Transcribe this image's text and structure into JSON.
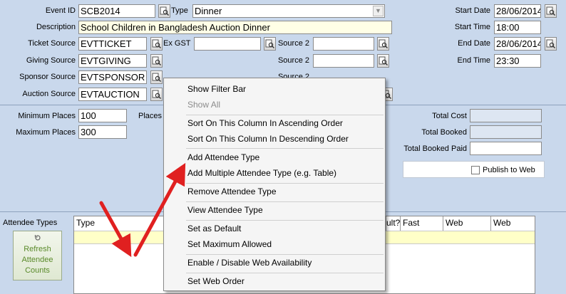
{
  "form": {
    "event_id_label": "Event ID",
    "event_id": "SCB2014",
    "type_label": "Type",
    "type_value": "Dinner",
    "description_label": "Description",
    "description": "School Children in Bangladesh Auction Dinner",
    "ticket_source_label": "Ticket Source",
    "ticket_source": "EVTTICKET",
    "ex_gst_label": "Ex GST",
    "source2_label": "Source 2",
    "giving_source_label": "Giving Source",
    "giving_source": "EVTGIVING",
    "sponsor_source_label": "Sponsor Source",
    "sponsor_source": "EVTSPONSOR",
    "auction_source_label": "Auction Source",
    "auction_source": "EVTAUCTION",
    "start_date_label": "Start Date",
    "start_date": "28/06/2014",
    "start_time_label": "Start Time",
    "start_time": "18:00",
    "end_date_label": "End Date",
    "end_date": "28/06/2014",
    "end_time_label": "End Time",
    "end_time": "23:30",
    "min_places_label": "Minimum Places",
    "min_places": "100",
    "max_places_label": "Maximum Places",
    "max_places": "300",
    "places_label": "Places",
    "total_cost_label": "Total Cost",
    "total_booked_label": "Total Booked",
    "total_booked_paid_label": "Total Booked Paid",
    "publish_label": "Publish to Web"
  },
  "attendee": {
    "label": "Attendee Types",
    "refresh_button": [
      "Refresh",
      "Attendee",
      "Counts"
    ],
    "columns": [
      "Type",
      "ult?",
      "Fast",
      "Web",
      "Web"
    ]
  },
  "context_menu": {
    "items": [
      {
        "label": "Show Filter Bar",
        "disabled": false
      },
      {
        "label": "Show All",
        "disabled": true
      },
      {
        "label": "Sort On This Column In Ascending Order",
        "disabled": false
      },
      {
        "label": "Sort On This Column In Descending Order",
        "disabled": false
      },
      {
        "label": "Add Attendee Type",
        "disabled": false
      },
      {
        "label": "Add Multiple Attendee Type (e.g. Table)",
        "disabled": false
      },
      {
        "label": "Remove Attendee Type",
        "disabled": false
      },
      {
        "label": "View Attendee Type",
        "disabled": false
      },
      {
        "label": "Set as Default",
        "disabled": false
      },
      {
        "label": "Set Maximum Allowed",
        "disabled": false
      },
      {
        "label": "Enable / Disable Web Availability",
        "disabled": false
      },
      {
        "label": "Set Web Order",
        "disabled": false
      }
    ]
  },
  "colors": {
    "background": "#c9d8ec",
    "row_highlight": "#ffffc8",
    "annotation_arrow": "#e02020",
    "refresh_text": "#5a8a2a"
  },
  "icons": {
    "lookup": "document-magnifier-icon",
    "refresh": "refresh-icon",
    "dropdown": "chevron-down-icon"
  }
}
